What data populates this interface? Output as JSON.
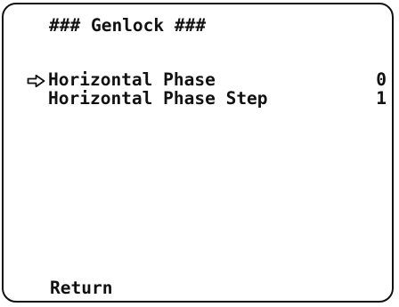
{
  "menu": {
    "title": "### Genlock ###",
    "cursor_icon": "hollow-right-arrow-icon",
    "items": [
      {
        "label": "Horizontal Phase",
        "value": "0",
        "selected": true
      },
      {
        "label": "Horizontal Phase Step",
        "value": "1",
        "selected": false
      }
    ],
    "return_label": "Return"
  },
  "colors": {
    "text": "#111111",
    "background": "#ffffff",
    "border": "#111111"
  }
}
